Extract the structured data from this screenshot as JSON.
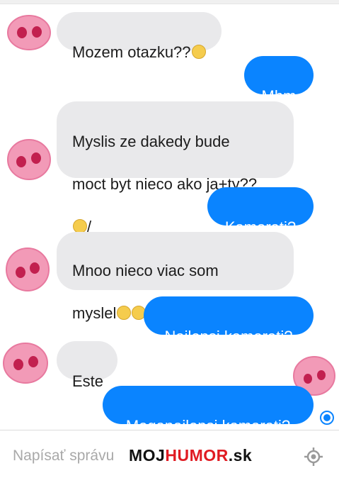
{
  "messages": [
    {
      "from": "them",
      "text": "Mozem otazku??",
      "emoji": [
        "smirk-face"
      ]
    },
    {
      "from": "me",
      "text": "Mhm"
    },
    {
      "from": "them",
      "line1": "Myslis ze dakedy bude",
      "line2": "moct byt nieco ako ja+ty??",
      "line3": "/",
      "emoji": [
        "confused-face"
      ]
    },
    {
      "from": "me",
      "text": "Kamarati?"
    },
    {
      "from": "them",
      "line1": "Mnoo nieco viac som",
      "line2": "myslel",
      "emoji": [
        "smirk-face",
        "smirk-face"
      ]
    },
    {
      "from": "me",
      "text": "Najlepsi kamarati?"
    },
    {
      "from": "them",
      "text": "Este"
    },
    {
      "from": "me",
      "text": "Meganajlepsi kamarati?"
    }
  ],
  "composer": {
    "placeholder": "Napísať správu",
    "watermark": {
      "part1": "MOJ",
      "part2": "HUMOR",
      "part3": ".sk"
    },
    "icon": "location-icon"
  },
  "colors": {
    "outgoing": "#0a84ff",
    "incoming": "#e9e9eb",
    "avatar": "#f29ab7",
    "watermark_accent": "#e01b22"
  }
}
